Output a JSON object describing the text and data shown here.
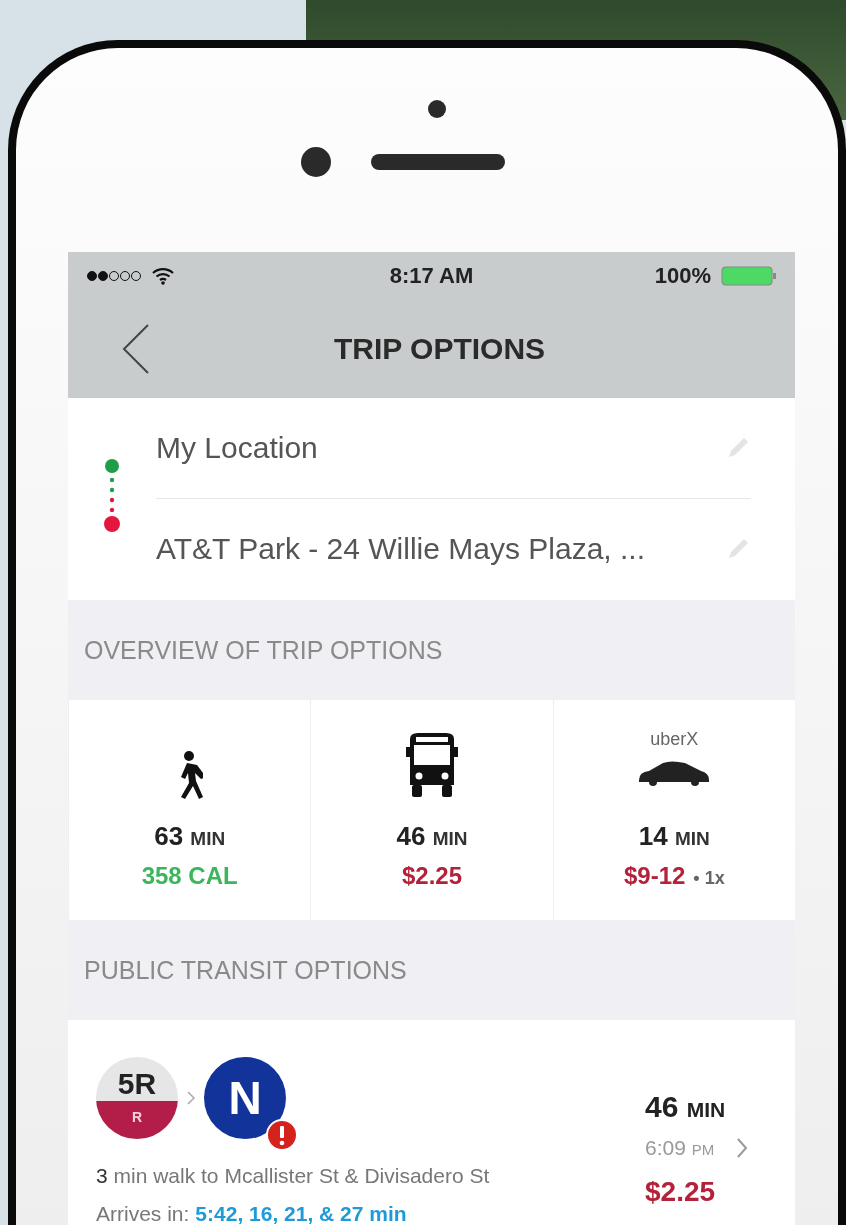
{
  "status_bar": {
    "time": "8:17 AM",
    "battery": "100%"
  },
  "nav_bar": {
    "title": "TRIP OPTIONS"
  },
  "route": [
    {
      "name": "My Location",
      "color": "#1f9d48"
    },
    {
      "name": "AT&T Park - 24 Willie Mays Plaza, ...",
      "color": "#e3173e"
    }
  ],
  "overview_header": "OVERVIEW OF TRIP OPTIONS",
  "overview": [
    {
      "kind": "walk",
      "duration": "63",
      "unit": "MIN",
      "detail": "358 CAL",
      "color": "#3db55b"
    },
    {
      "kind": "bus",
      "duration": "46",
      "unit": "MIN",
      "detail": "$2.25",
      "color": "#b3223a"
    },
    {
      "kind": "car",
      "label": "uberX",
      "duration": "14",
      "unit": "MIN",
      "detail": "$9-12",
      "surge": "• 1x",
      "color": "#b3223a"
    }
  ],
  "transit_header": "PUBLIC TRANSIT OPTIONS",
  "transit_options": [
    {
      "routes": [
        {
          "kind": "bus",
          "label": "5R",
          "sublabel": "R",
          "alert": false
        },
        {
          "kind": "train",
          "label": "N",
          "alert": true
        }
      ],
      "duration": "46",
      "unit": "MIN",
      "depart": "6:09",
      "depart_unit": "PM",
      "fare": "$2.25",
      "walk": "**3** min walk to Mcallister St & Divisadero St",
      "arrivals_label": "Arrives in:",
      "arrivals": "5:42, 16, 21, & 27 min"
    }
  ]
}
